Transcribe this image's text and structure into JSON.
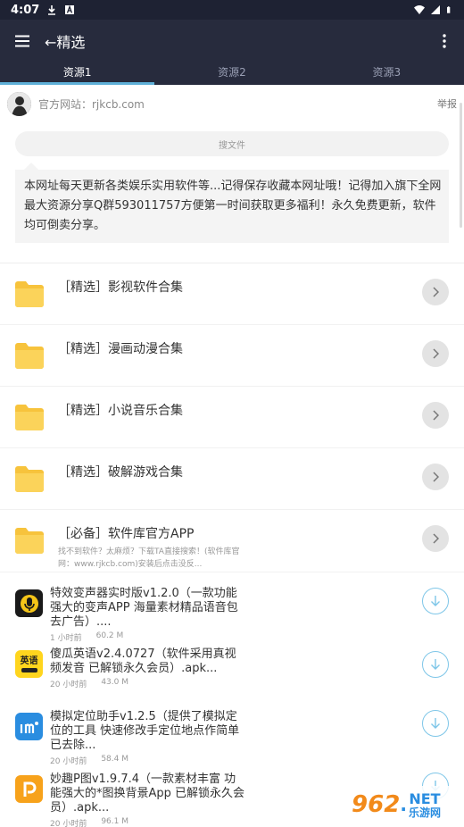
{
  "status_bar": {
    "time": "4:07"
  },
  "app_bar": {
    "title": "←精选"
  },
  "tabs": [
    {
      "label": "资源1",
      "active": true
    },
    {
      "label": "资源2",
      "active": false
    },
    {
      "label": "资源3",
      "active": false
    }
  ],
  "site": {
    "label": "官方网站：rjkcb.com",
    "report": "举报"
  },
  "search": {
    "placeholder": "搜文件"
  },
  "notice": {
    "text": "本网址每天更新各类娱乐实用软件等...记得保存收藏本网址哦！记得加入旗下全网最大资源分享Q群593011757方便第一时间获取更多福利！永久免费更新，软件均可倒卖分享。"
  },
  "folders": [
    {
      "title": "［精选］影视软件合集",
      "desc": ""
    },
    {
      "title": "［精选］漫画动漫合集",
      "desc": ""
    },
    {
      "title": "［精选］小说音乐合集",
      "desc": ""
    },
    {
      "title": "［精选］破解游戏合集",
      "desc": ""
    },
    {
      "title": "［必备］软件库官方APP",
      "desc": "找不到软件？太麻烦？下载TA直接搜索！(软件库官网：www.rjkcb.com)安装后点击没反..."
    }
  ],
  "files": [
    {
      "title": "特效变声器实时版v1.2.0（一款功能强大的变声APP 海量素材精品语音包 去广告）....",
      "time": "1 小时前",
      "size": "60.2 M",
      "icon": "voice-changer-icon"
    },
    {
      "title": "傻瓜英语v2.4.0727（软件采用真视频发音 已解锁永久会员）.apk...",
      "time": "20 小时前",
      "size": "43.0 M",
      "icon": "english-app-icon",
      "icon_text": "英语"
    },
    {
      "title": "模拟定位助手v1.2.5（提供了模拟定位的工具 快速修改手定位地点作简单 已去除...",
      "time": "20 小时前",
      "size": "58.4 M",
      "icon": "location-app-icon"
    },
    {
      "title": "妙趣P图v1.9.7.4（一款素材丰富 功能强大的*图换背景App 已解锁永久会员）.apk...",
      "time": "20 小时前",
      "size": "96.1 M",
      "icon": "photo-app-icon"
    }
  ],
  "watermark": {
    "number": "962",
    "dot": ".",
    "net": "NET",
    "cn": "乐游网"
  },
  "colors": {
    "header": "#272b3d",
    "status": "#1e2233",
    "accent": "#5fb0d8",
    "folder": "#f7c33c"
  }
}
